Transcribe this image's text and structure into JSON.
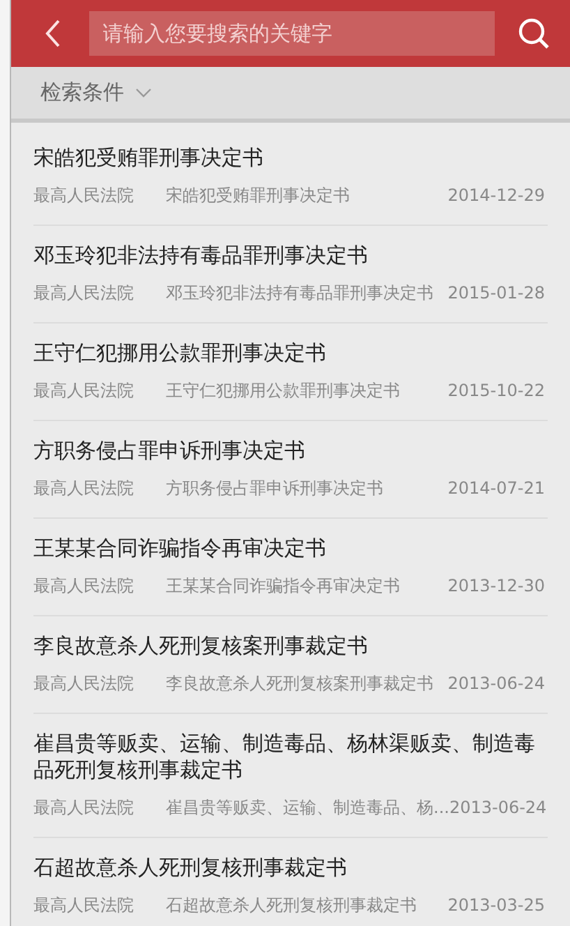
{
  "header": {
    "search": {
      "placeholder": "请输入您要搜索的关键字"
    }
  },
  "filter": {
    "label": "检索条件"
  },
  "results": [
    {
      "title": "宋皓犯受贿罪刑事决定书",
      "court": "最高人民法院",
      "summary": "宋皓犯受贿罪刑事决定书",
      "date": "2014-12-29"
    },
    {
      "title": "邓玉玲犯非法持有毒品罪刑事决定书",
      "court": "最高人民法院",
      "summary": "邓玉玲犯非法持有毒品罪刑事决定书",
      "date": "2015-01-28"
    },
    {
      "title": "王守仁犯挪用公款罪刑事决定书",
      "court": "最高人民法院",
      "summary": "王守仁犯挪用公款罪刑事决定书",
      "date": "2015-10-22"
    },
    {
      "title": "方职务侵占罪申诉刑事决定书",
      "court": "最高人民法院",
      "summary": "方职务侵占罪申诉刑事决定书",
      "date": "2014-07-21"
    },
    {
      "title": "王某某合同诈骗指令再审决定书",
      "court": "最高人民法院",
      "summary": "王某某合同诈骗指令再审决定书",
      "date": "2013-12-30"
    },
    {
      "title": "李良故意杀人死刑复核案刑事裁定书",
      "court": "最高人民法院",
      "summary": "李良故意杀人死刑复核案刑事裁定书",
      "date": "2013-06-24"
    },
    {
      "title": "崔昌贵等贩卖、运输、制造毒品、杨林渠贩卖、制造毒品死刑复核刑事裁定书",
      "court": "最高人民法院",
      "summary": "崔昌贵等贩卖、运输、制造毒品、杨...",
      "date": "2013-06-24"
    },
    {
      "title": "石超故意杀人死刑复核刑事裁定书",
      "court": "最高人民法院",
      "summary": "石超故意杀人死刑复核刑事裁定书",
      "date": "2013-03-25"
    }
  ]
}
